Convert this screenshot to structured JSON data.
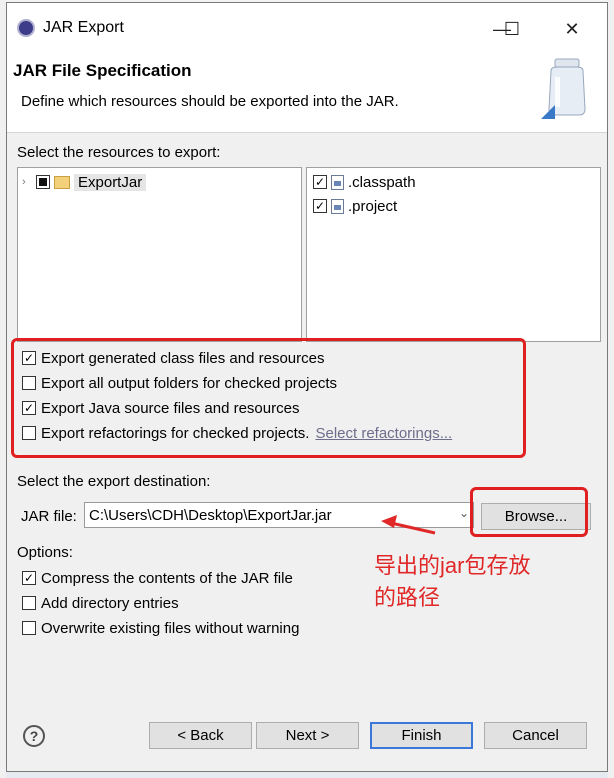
{
  "window": {
    "title": "JAR Export",
    "minimize_glyph": "—",
    "maximize_glyph": "☐",
    "close_glyph": "✕"
  },
  "header": {
    "title": "JAR File Specification",
    "description": "Define which resources should be exported into the JAR."
  },
  "resources": {
    "label": "Select the resources to export:",
    "tree": [
      {
        "label": "ExportJar",
        "state": "partial",
        "icon": "project-folder-icon"
      }
    ],
    "files": [
      {
        "label": ".classpath",
        "checked": true,
        "icon": "file-icon"
      },
      {
        "label": ".project",
        "checked": true,
        "icon": "file-icon"
      }
    ]
  },
  "options_export": [
    {
      "label": "Export generated class files and resources",
      "checked": true
    },
    {
      "label": "Export all output folders for checked projects",
      "checked": false
    },
    {
      "label": "Export Java source files and resources",
      "checked": true
    },
    {
      "label": "Export refactorings for checked projects.",
      "checked": false,
      "link": "Select refactorings..."
    }
  ],
  "destination": {
    "label": "Select the export destination:",
    "jar_label": "JAR file:",
    "jar_value": "C:\\Users\\CDH\\Desktop\\ExportJar.jar",
    "browse_label": "Browse..."
  },
  "options": {
    "label": "Options:",
    "items": [
      {
        "label": "Compress the contents of the JAR file",
        "checked": true
      },
      {
        "label": "Add directory entries",
        "checked": false
      },
      {
        "label": "Overwrite existing files without warning",
        "checked": false
      }
    ]
  },
  "annotation": {
    "line1": "导出的jar包存放",
    "line2": "的路径",
    "color": "#e02828"
  },
  "buttons": {
    "help": "?",
    "back": "< Back",
    "next": "Next >",
    "finish": "Finish",
    "cancel": "Cancel"
  }
}
